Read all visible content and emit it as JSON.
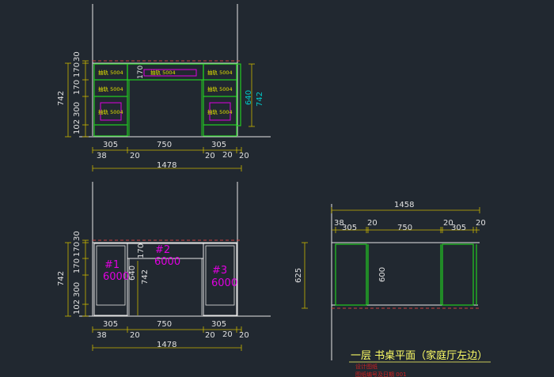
{
  "colors": {
    "background": "#212830",
    "line_white": "#e6e6e6",
    "frame_green": "#22cc22",
    "dim_yellow": "#c8b400",
    "dim_text_white": "#e0e0e0",
    "magenta": "#e000e0",
    "cyan": "#00c8c8",
    "red_dash": "#d04040",
    "red_text": "#d02020",
    "title_yellow": "#ffff66"
  },
  "top_elevation": {
    "vertical_dims": [
      "30",
      "170",
      "170",
      "170",
      "300",
      "742",
      "102"
    ],
    "drawer_labels": [
      "抽轨 5004",
      "抽轨 5004",
      "抽轨 5004",
      "抽轨 5004",
      "抽轨 5004",
      "抽轨 5004",
      "抽轨 5004"
    ],
    "center_label": "170",
    "right_dims": [
      "640",
      "742"
    ],
    "bottom_dims_row1": [
      "305",
      "750",
      "305"
    ],
    "bottom_dims_row2": [
      "38",
      "20",
      "20",
      "20",
      "20"
    ],
    "total": "1478"
  },
  "bottom_elevation": {
    "vertical_dims": [
      "30",
      "170",
      "170",
      "742",
      "300",
      "102"
    ],
    "units": [
      {
        "id": "#1",
        "value": "6000"
      },
      {
        "id": "#2",
        "value": "6000"
      },
      {
        "id": "#3",
        "value": "6000"
      }
    ],
    "inner_dims": [
      "170",
      "640",
      "742"
    ],
    "bottom_dims_row1": [
      "305",
      "750",
      "305"
    ],
    "bottom_dims_row2": [
      "38",
      "20",
      "20",
      "20",
      "20"
    ],
    "total": "1478"
  },
  "plan": {
    "total": "1458",
    "dims_row": [
      "38",
      "305",
      "20",
      "750",
      "20",
      "305",
      "20"
    ],
    "depth_outer": "625",
    "depth_inner": "600"
  },
  "title_block": {
    "title": "一层 书桌平面（家庭厅左边）",
    "line1": "设计图纸",
    "line2": "图纸编号及日期 001"
  }
}
